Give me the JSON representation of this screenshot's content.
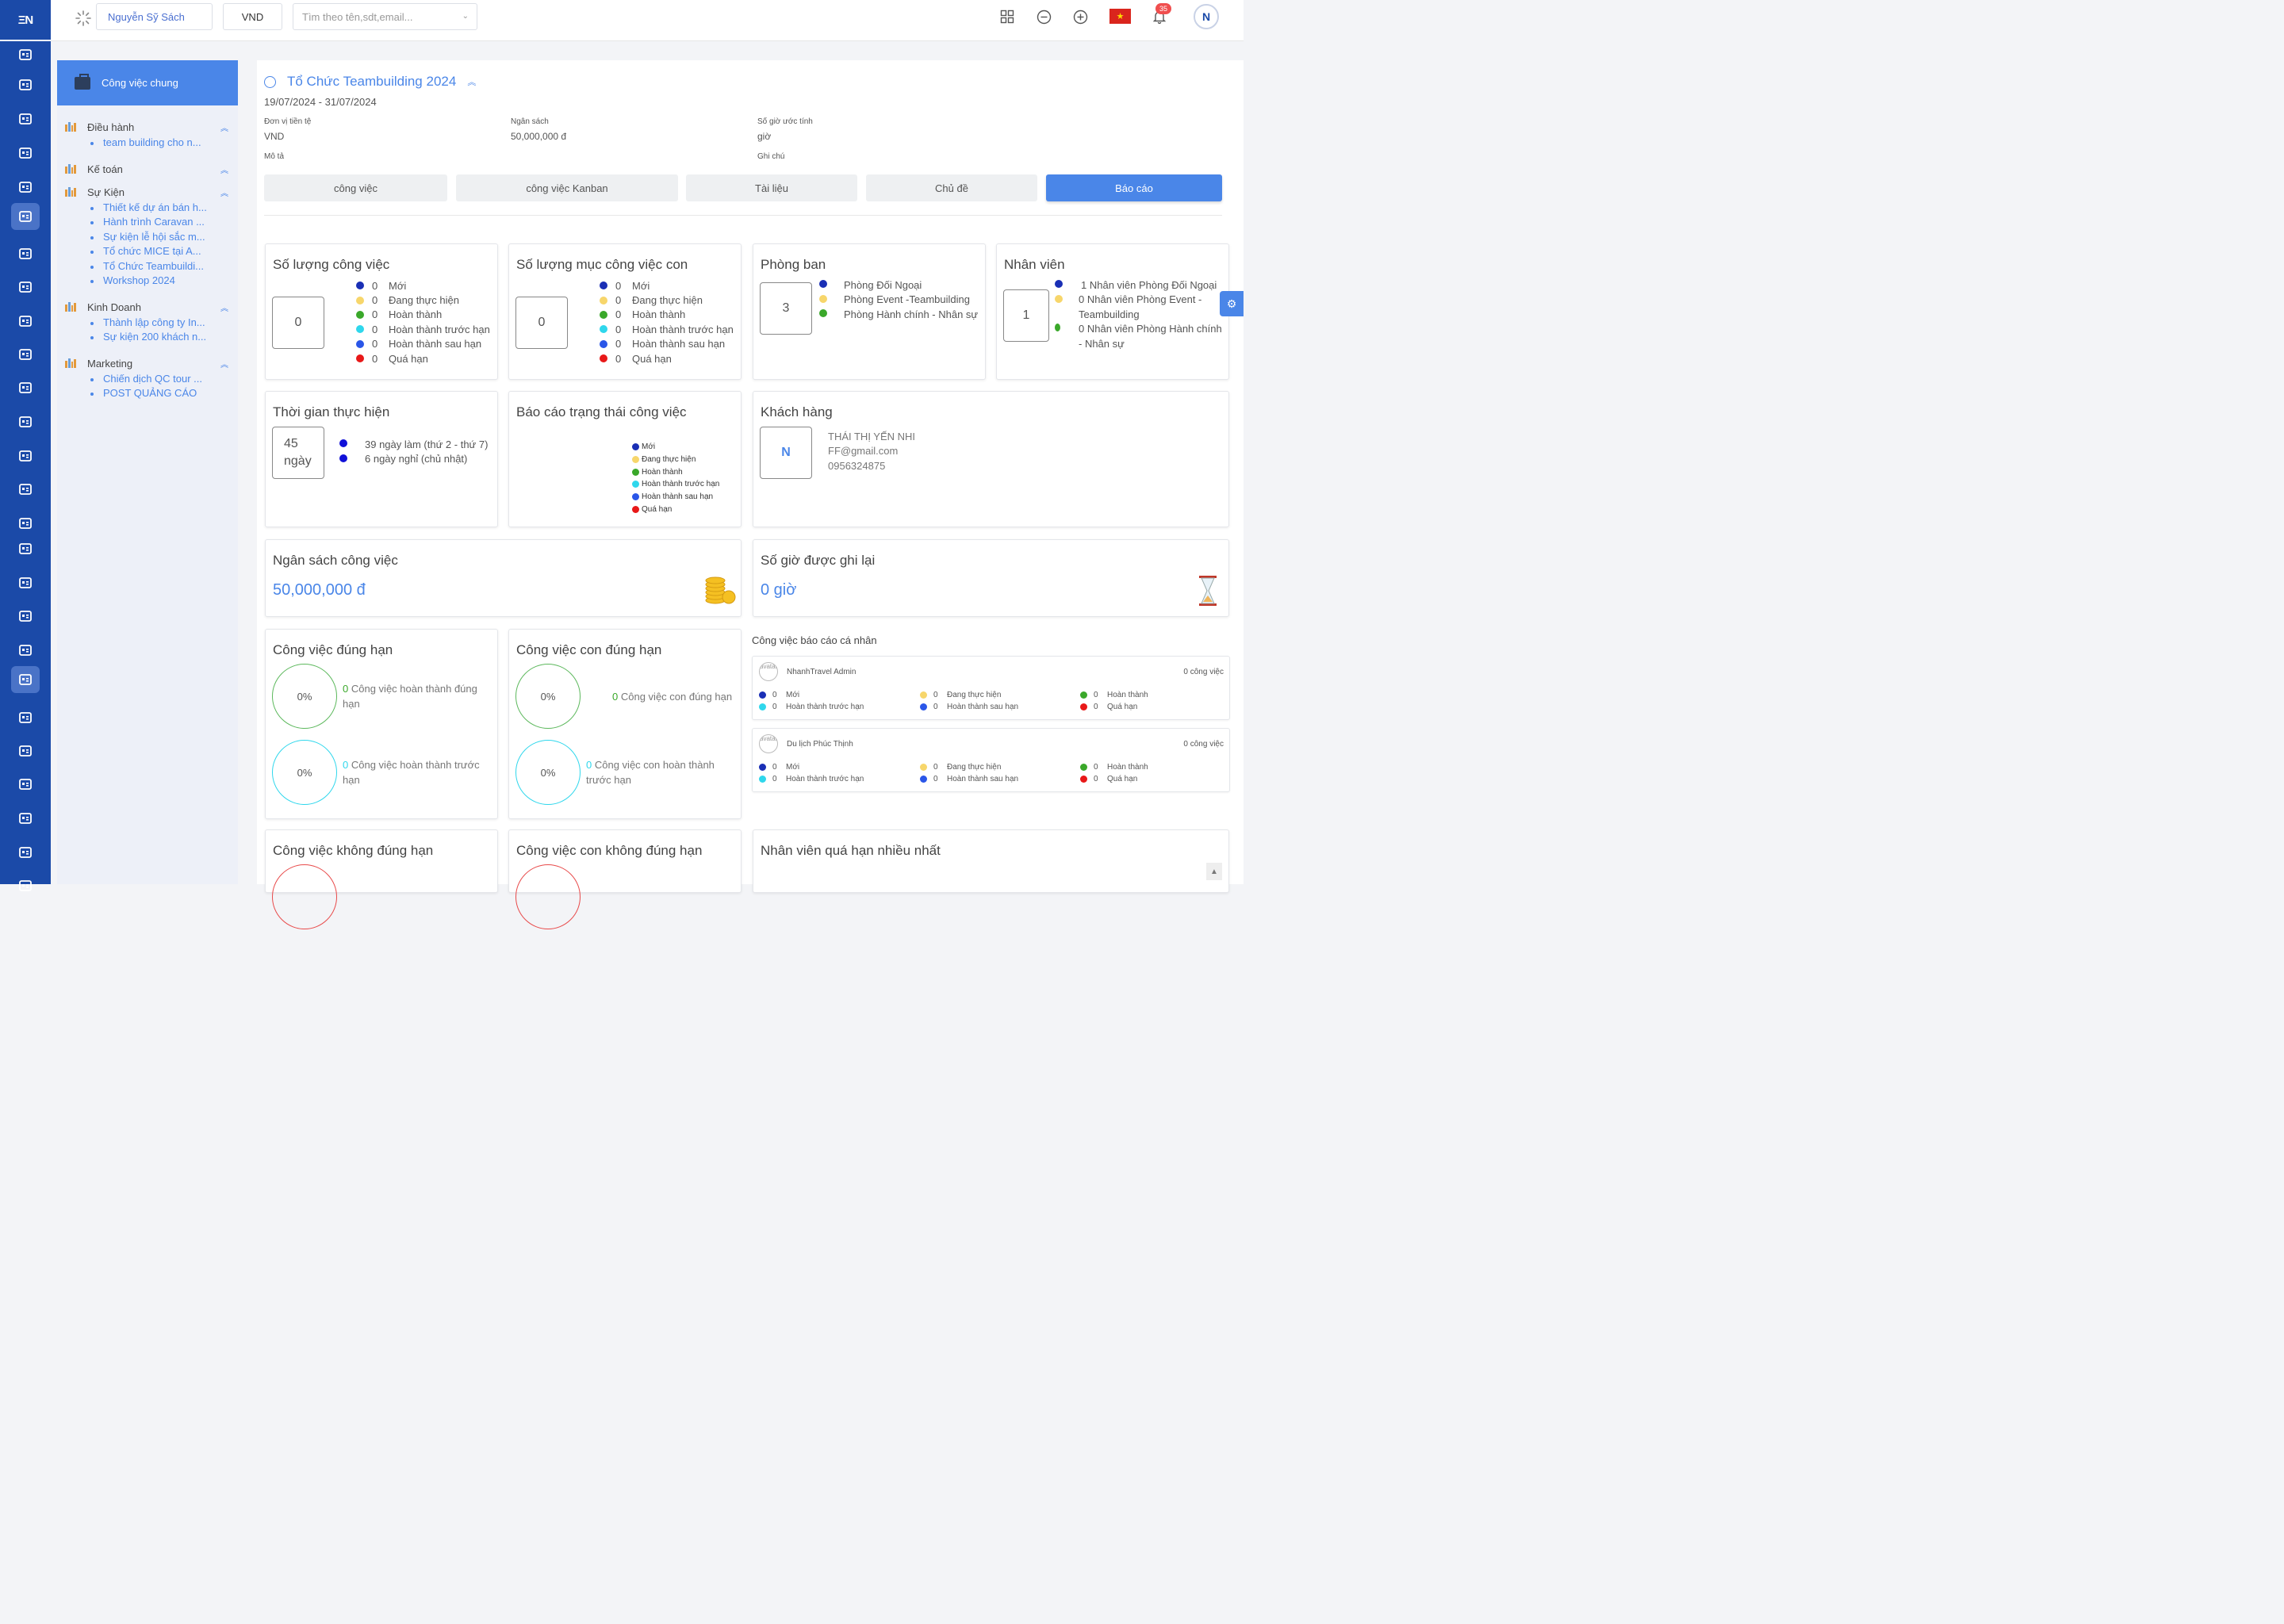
{
  "rail": {
    "logo": "ΞN"
  },
  "topbar": {
    "user": "Nguyễn Sỹ Sách",
    "currency": "VND",
    "search_placeholder": "Tìm theo tên,sdt,email...",
    "notif_count": "35",
    "avatar_letter": "N"
  },
  "projnav": {
    "header": "Công việc chung",
    "groups": [
      {
        "title": "Điều hành",
        "items": [
          "team building cho n..."
        ]
      },
      {
        "title": "Kế toán",
        "items": []
      },
      {
        "title": "Sự Kiện",
        "items": [
          "Thiết kế dự án bán h...",
          "Hành trình Caravan ...",
          "Sự kiện lễ hội sắc m...",
          "Tổ chức MICE tại A...",
          "Tổ Chức Teambuildi...",
          "Workshop 2024"
        ]
      },
      {
        "title": "Kinh Doanh",
        "items": [
          "Thành lập công ty In...",
          "Sự kiện 200 khách n..."
        ]
      },
      {
        "title": "Marketing",
        "items": [
          "Chiến dịch QC tour ...",
          "POST QUẢNG CÁO"
        ]
      }
    ]
  },
  "project": {
    "title": "Tổ Chức Teambuilding 2024",
    "dates": "19/07/2024 - 31/07/2024",
    "currency_label": "Đơn vị tiền tệ",
    "currency_value": "VND",
    "budget_label": "Ngân sách",
    "budget_value": "50,000,000 đ",
    "hours_label": "Số giờ ước tính",
    "hours_value": "giờ",
    "desc_label": "Mô tả",
    "note_label": "Ghi chú"
  },
  "tabs": [
    "công việc",
    "công việc Kanban",
    "Tài liệu",
    "Chủ đề",
    "Báo cáo"
  ],
  "status_colors": {
    "new": "#1a2fb5",
    "doing": "#f7d66b",
    "done": "#3aa82a",
    "early": "#2fd7ec",
    "late": "#2a56e8",
    "overdue": "#e81818"
  },
  "status_labels": [
    "Mới",
    "Đang thực hiện",
    "Hoàn thành",
    "Hoàn thành trước hạn",
    "Hoàn thành sau hạn",
    "Quá hạn"
  ],
  "task_count": {
    "title": "Số lượng công việc",
    "total": "0",
    "counts": [
      "0",
      "0",
      "0",
      "0",
      "0",
      "0"
    ]
  },
  "subtask_count": {
    "title": "Số lượng mục công việc con",
    "total": "0",
    "counts": [
      "0",
      "0",
      "0",
      "0",
      "0",
      "0"
    ]
  },
  "departments": {
    "title": "Phòng ban",
    "total": "3",
    "items": [
      "Phòng Đối Ngoại",
      "Phòng Event -Teambuilding",
      "Phòng Hành chính - Nhân sự"
    ]
  },
  "staff": {
    "title": "Nhân viên",
    "total": "1",
    "items": [
      "1 Nhân viên Phòng Đối Ngoại",
      "0 Nhân viên Phòng Event - Teambuilding",
      "0 Nhân viên Phòng Hành chính - Nhân sự"
    ]
  },
  "duration": {
    "title": "Thời gian thực hiện",
    "total": "45 ngày",
    "items": [
      "39 ngày làm (thứ 2 - thứ 7)",
      "6 ngày nghỉ (chủ nhật)"
    ]
  },
  "status_report": {
    "title": "Báo cáo trạng thái công việc"
  },
  "customer": {
    "title": "Khách hàng",
    "logo": "N",
    "name": "THÁI THỊ YẾN NHI",
    "email": "FF@gmail.com",
    "phone": "0956324875"
  },
  "budget": {
    "title": "Ngân sách công việc",
    "value": "50,000,000 đ"
  },
  "hours": {
    "title": "Số giờ được ghi lại",
    "value": "0 giờ"
  },
  "ontime": {
    "title": "Công việc đúng hạn",
    "ring1": "0%",
    "ring1_count": "0",
    "ring1_text": "Công việc hoàn thành đúng hạn",
    "ring2": "0%",
    "ring2_count": "0",
    "ring2_text": "Công việc hoàn thành trước hạn"
  },
  "sub_ontime": {
    "title": "Công việc con đúng hạn",
    "ring1": "0%",
    "ring1_count": "0",
    "ring1_text": "Công việc con đúng hạn",
    "ring2": "0%",
    "ring2_count": "0",
    "ring2_text": "Công việc con hoàn thành trước hạn"
  },
  "personal": {
    "title": "Công việc báo cáo cá nhân",
    "people": [
      {
        "avatar_alt": "avatar",
        "name": "NhanhTravel Admin",
        "count": "0 công việc",
        "counts": [
          "0",
          "0",
          "0",
          "0",
          "0",
          "0"
        ]
      },
      {
        "avatar_alt": "avatar",
        "name": "Du lịch Phúc Thịnh",
        "count": "0 công việc",
        "counts": [
          "0",
          "0",
          "0",
          "0",
          "0",
          "0"
        ]
      }
    ]
  },
  "late": {
    "title": "Công việc không đúng hạn"
  },
  "sub_late": {
    "title": "Công việc con không đúng hạn"
  },
  "top_overdue": {
    "title": "Nhân viên quá hạn nhiều nhất"
  }
}
